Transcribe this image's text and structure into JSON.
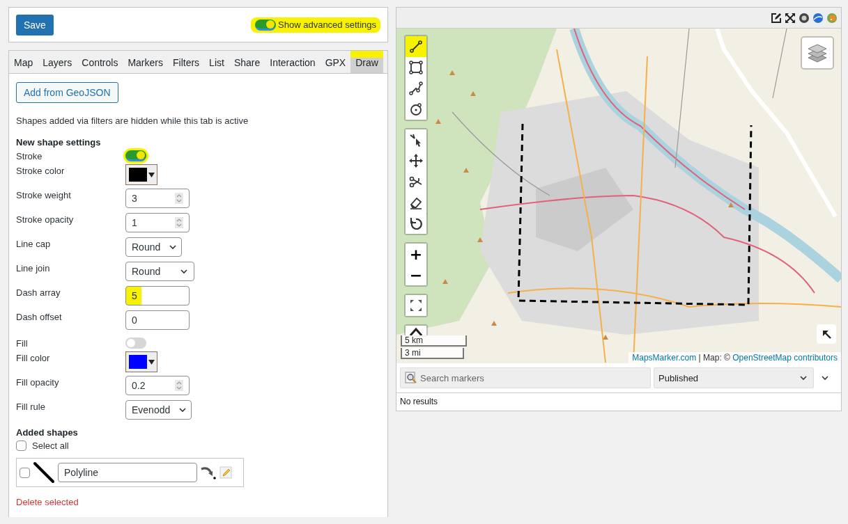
{
  "top_bar": {
    "save_button": "Save",
    "advanced_toggle": {
      "label": "Show advanced settings",
      "on": true,
      "highlighted": true
    }
  },
  "tabs": [
    {
      "label": "Map",
      "selected": false,
      "highlighted": false
    },
    {
      "label": "Layers",
      "selected": false,
      "highlighted": false
    },
    {
      "label": "Controls",
      "selected": false,
      "highlighted": false
    },
    {
      "label": "Markers",
      "selected": false,
      "highlighted": false
    },
    {
      "label": "Filters",
      "selected": false,
      "highlighted": false
    },
    {
      "label": "List",
      "selected": false,
      "highlighted": false
    },
    {
      "label": "Share",
      "selected": false,
      "highlighted": false
    },
    {
      "label": "Interaction",
      "selected": false,
      "highlighted": false
    },
    {
      "label": "GPX",
      "selected": false,
      "highlighted": false
    },
    {
      "label": "Draw",
      "selected": true,
      "highlighted": true
    }
  ],
  "draw_tab": {
    "add_button": "Add from GeoJSON",
    "note": "Shapes added via filters are hidden while this tab is active",
    "settings_heading": "New shape settings",
    "settings": [
      {
        "kind": "toggle",
        "label": "Stroke",
        "on": true,
        "highlighted": true
      },
      {
        "kind": "color",
        "label": "Stroke color",
        "color": "#000000"
      },
      {
        "kind": "number",
        "label": "Stroke weight",
        "value": "3"
      },
      {
        "kind": "number",
        "label": "Stroke opacity",
        "value": "1"
      },
      {
        "kind": "select",
        "label": "Line cap",
        "value": "Round"
      },
      {
        "kind": "select",
        "label": "Line join",
        "value": "Round"
      },
      {
        "kind": "text",
        "label": "Dash array",
        "value": "5",
        "highlighted": true
      },
      {
        "kind": "text",
        "label": "Dash offset",
        "value": "0",
        "highlighted": false
      },
      {
        "kind": "toggle",
        "label": "Fill",
        "on": false,
        "highlighted": false
      },
      {
        "kind": "color",
        "label": "Fill color",
        "color": "#0000ff"
      },
      {
        "kind": "number",
        "label": "Fill opacity",
        "value": "0.2"
      },
      {
        "kind": "select",
        "label": "Fill rule",
        "value": "Evenodd"
      }
    ],
    "added_heading": "Added shapes",
    "select_all": {
      "label": "Select all",
      "checked": false
    },
    "shapes": [
      {
        "name": "Polyline",
        "checked": false
      }
    ],
    "delete_link": "Delete selected"
  },
  "map_panel": {
    "draw_tools": [
      {
        "kind": "line",
        "highlighted": true
      },
      {
        "kind": "rectangle",
        "highlighted": false
      },
      {
        "kind": "polyline",
        "highlighted": false
      },
      {
        "kind": "circle",
        "highlighted": false
      }
    ],
    "edit_tools": [
      {
        "kind": "select"
      },
      {
        "kind": "move"
      },
      {
        "kind": "cut"
      },
      {
        "kind": "erase"
      },
      {
        "kind": "rotate"
      }
    ],
    "zoom_in": "+",
    "zoom_out": "−",
    "scale": [
      "5 km",
      "3 mi"
    ],
    "attribution": {
      "link_1": "MapsMarker.com",
      "text": "| Map: ©",
      "link_2": "OpenStreetMap contributors"
    },
    "search_placeholder": "Search markers",
    "status_select": "Published",
    "empty_text": "No results"
  }
}
